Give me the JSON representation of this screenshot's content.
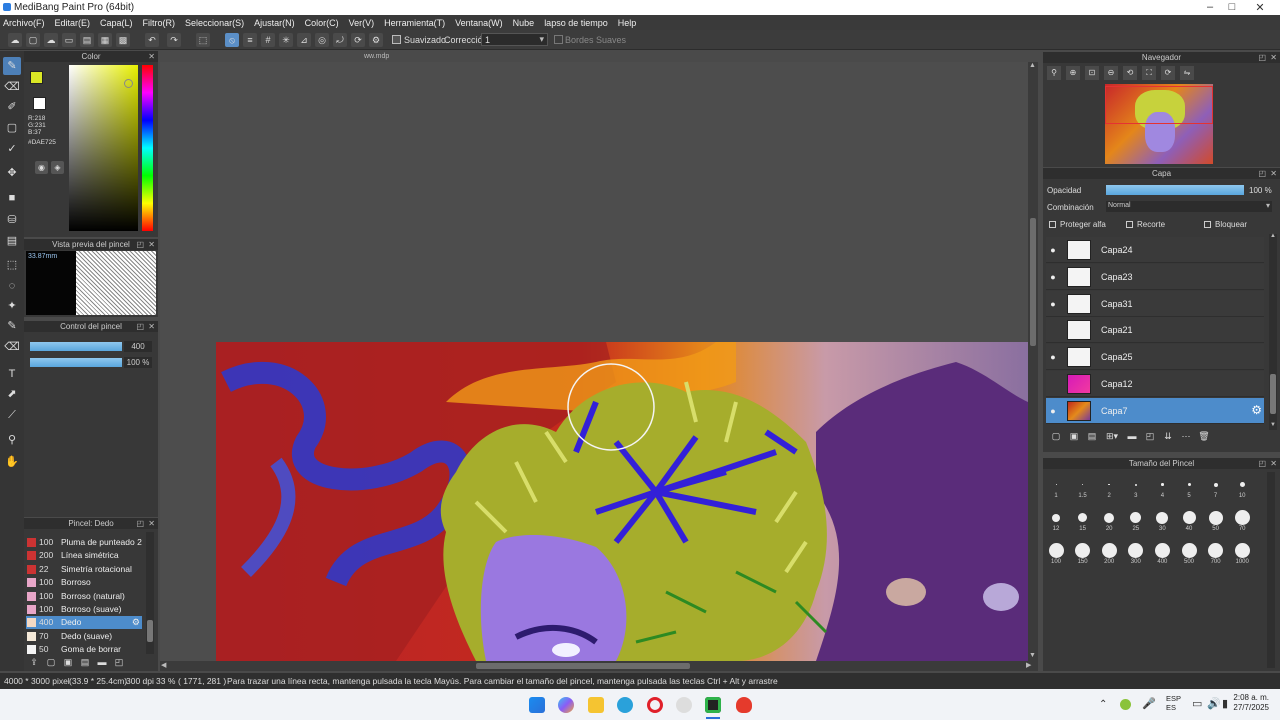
{
  "window": {
    "title": "MediBang Paint Pro (64bit)",
    "minimize": "–",
    "maximize": "□",
    "close": "✕"
  },
  "menu": [
    "Archivo(F)",
    "Editar(E)",
    "Capa(L)",
    "Filtro(R)",
    "Seleccionar(S)",
    "Ajustar(N)",
    "Color(C)",
    "Ver(V)",
    "Herramienta(T)",
    "Ventana(W)",
    "Nube",
    "lapso de tiempo",
    "Help"
  ],
  "toolbar": {
    "suavizado_label": "Suavizado",
    "correccion_label": "Corrección",
    "correccion_value": "1",
    "bordes_label": "Bordes Suaves"
  },
  "document": {
    "tab": "ww.mdp"
  },
  "color_panel": {
    "title": "Color",
    "r": "R:218",
    "g": "G:231",
    "b": "B:37",
    "hex": "#DAE725",
    "primary": "#dae725"
  },
  "brush_preview": {
    "title": "Vista previa del pincel",
    "size": "33.87mm"
  },
  "brush_control": {
    "title": "Control del pincel",
    "size_value": "400",
    "opacity_value": "100 %"
  },
  "brush_list": {
    "title": "Pincel: Dedo",
    "items": [
      {
        "n": "100",
        "label": "Pluma de punteado 2",
        "color": "#cc3333"
      },
      {
        "n": "200",
        "label": "Línea simétrica",
        "color": "#cc3333"
      },
      {
        "n": "22",
        "label": "Simetría rotacional",
        "color": "#cc3333"
      },
      {
        "n": "100",
        "label": "Borroso",
        "color": "#e8a6c8"
      },
      {
        "n": "100",
        "label": "Borroso (natural)",
        "color": "#e8a6c8"
      },
      {
        "n": "100",
        "label": "Borroso (suave)",
        "color": "#e8a6c8"
      },
      {
        "n": "400",
        "label": "Dedo",
        "color": "#f4d9c4"
      },
      {
        "n": "70",
        "label": "Dedo (suave)",
        "color": "#f4e9d8"
      },
      {
        "n": "50",
        "label": "Goma de borrar",
        "color": "#f4f4f4"
      }
    ]
  },
  "navigator": {
    "title": "Navegador"
  },
  "layer_panel": {
    "title": "Capa",
    "opacity_label": "Opacidad",
    "opacity_value": "100 %",
    "opacity": 1.0,
    "blend_label": "Combinación",
    "blend_value": "Normal",
    "protect_alpha": "Proteger alfa",
    "clip": "Recorte",
    "lock": "Bloquear",
    "layers": [
      {
        "name": "Capa24",
        "visible": true,
        "thumb": "white"
      },
      {
        "name": "Capa23",
        "visible": true,
        "thumb": "white"
      },
      {
        "name": "Capa31",
        "visible": true,
        "thumb": "white"
      },
      {
        "name": "Capa21",
        "visible": false,
        "thumb": "white"
      },
      {
        "name": "Capa25",
        "visible": true,
        "thumb": "white"
      },
      {
        "name": "Capa12",
        "visible": false,
        "thumb": "pink"
      },
      {
        "name": "Capa7",
        "visible": true,
        "thumb": "art"
      }
    ]
  },
  "brush_size": {
    "title": "Tamaño del Pincel",
    "sizes": [
      "1",
      "1.5",
      "2",
      "3",
      "4",
      "5",
      "7",
      "10",
      "12",
      "15",
      "20",
      "25",
      "30",
      "40",
      "50",
      "70",
      "100",
      "150",
      "200",
      "300",
      "400",
      "500",
      "700",
      "1000"
    ]
  },
  "status": {
    "dims": "4000 * 3000 pixel",
    "phys": "(33.9 * 25.4cm)",
    "dpi": "300 dpi",
    "zoom": "33 %",
    "coords": "( 1771, 281 )",
    "hint": "Para trazar una línea recta, mantenga pulsada la tecla Mayús. Para cambiar el tamaño del pincel, mantenga pulsada las teclas Ctrl + Alt y arrastre"
  },
  "taskbar": {
    "lang1": "ESP",
    "lang2": "ES",
    "time": "2:08 a. m.",
    "date": "27/7/2025"
  }
}
